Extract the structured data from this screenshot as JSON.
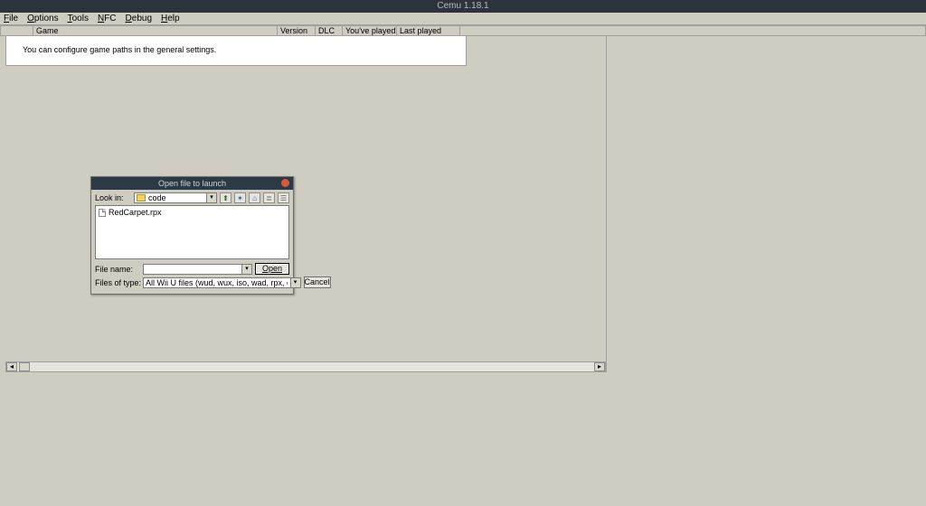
{
  "window": {
    "title": "Cemu 1.18.1"
  },
  "menu": {
    "file": {
      "label": "File",
      "accel": "F"
    },
    "options": {
      "label": "Options",
      "accel": "O"
    },
    "tools": {
      "label": "Tools",
      "accel": "T"
    },
    "nfc": {
      "label": "NFC",
      "accel": "N"
    },
    "debug": {
      "label": "Debug",
      "accel": "D"
    },
    "help": {
      "label": "Help",
      "accel": "H"
    }
  },
  "columns": {
    "game": "Game",
    "version": "Version",
    "dlc": "DLC",
    "youve_played": "You've played",
    "last_played": "Last played"
  },
  "gamelist": {
    "empty_hint": "You can configure game paths in the general settings."
  },
  "dialog": {
    "title": "Open file to launch",
    "look_in_label": "Look in:",
    "look_in_value": "code",
    "files": [
      "RedCarpet.rpx"
    ],
    "file_name_label": "File name:",
    "file_name_value": "",
    "file_type_label": "Files of type:",
    "file_type_value": "All Wii U files (wud, wux, iso, wad, rpx, elf)",
    "open_btn": "Open",
    "cancel_btn": "Cancel"
  }
}
